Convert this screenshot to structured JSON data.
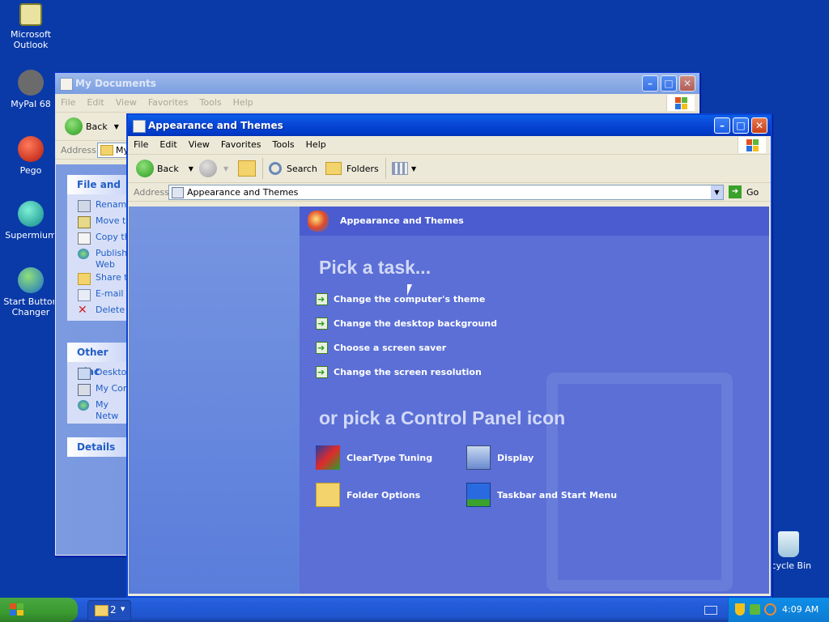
{
  "desktop": {
    "icons": [
      {
        "label": "Microsoft Outlook"
      },
      {
        "label": "MyPal 68"
      },
      {
        "label": "Pego"
      },
      {
        "label": "Supermium"
      },
      {
        "label": "Start Button Changer"
      },
      {
        "label": "ecycle Bin"
      }
    ]
  },
  "docs_window": {
    "title": "My Documents",
    "menu": [
      "File",
      "Edit",
      "View",
      "Favorites",
      "Tools",
      "Help"
    ],
    "back_label": "Back",
    "address_label": "Address",
    "address_value": "My",
    "file_tasks": {
      "header": "File and Fo",
      "items": [
        "Renam",
        "Move th",
        "Copy th",
        "Publish Web",
        "Share t",
        "E-mail t",
        "Delete"
      ]
    },
    "other_places": {
      "header": "Other Plac",
      "items": [
        "Desktop",
        "My Com",
        "My Netw"
      ]
    },
    "details": {
      "header": "Details"
    }
  },
  "cp_window": {
    "title": "Appearance and Themes",
    "menu": [
      "File",
      "Edit",
      "View",
      "Favorites",
      "Tools",
      "Help"
    ],
    "toolbar": {
      "back": "Back",
      "search": "Search",
      "folders": "Folders"
    },
    "address": {
      "label": "Address",
      "value": "Appearance and Themes",
      "go": "Go"
    },
    "header_title": "Appearance and Themes",
    "pick_task": "Pick a task...",
    "tasks": [
      "Change the computer's theme",
      "Change the desktop background",
      "Choose a screen saver",
      "Change the screen resolution"
    ],
    "pick_icon": "or pick a Control Panel icon",
    "icons": [
      {
        "label": "ClearType Tuning"
      },
      {
        "label": "Display"
      },
      {
        "label": "Folder Options"
      },
      {
        "label": "Taskbar and Start Menu"
      }
    ]
  },
  "taskbar": {
    "group_count": "2",
    "clock": "4:09 AM"
  },
  "colors": {
    "desktop": "#0a3aa8",
    "title_active": "#0a48d8",
    "cp_pane": "#5b6fd6",
    "start_green": "#3a9b31"
  }
}
